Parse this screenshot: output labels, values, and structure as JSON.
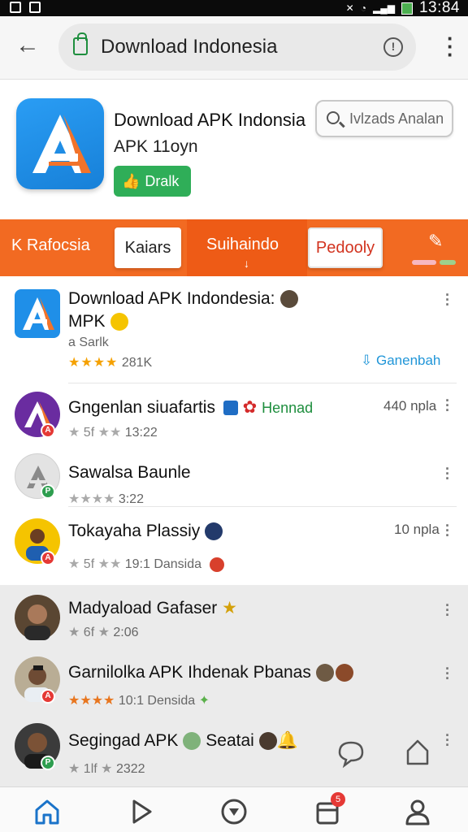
{
  "status_bar": {
    "time": "13:84"
  },
  "url_bar": {
    "title": "Download Indonesia"
  },
  "app_header": {
    "title": "Download APK Indonsia",
    "subtitle": "APK 11oyn",
    "download_label": "Dralk",
    "search_placeholder": "Ivlzads Analan"
  },
  "tabs": [
    {
      "label": "K Rafocsia"
    },
    {
      "label": "Kaiars"
    },
    {
      "label": "Suihaindo"
    },
    {
      "label": "Pedooly"
    }
  ],
  "list": [
    {
      "name": "Download APK Indondesia:",
      "name2": "MPK",
      "sub": "a Sarlk",
      "stars": "★★★★",
      "meta": "281K",
      "right": "Ganenbah",
      "badge_color": "",
      "avatar_color": "#1f8fe8"
    },
    {
      "name": "Gngenlan siuafartis",
      "extra": "Hennad",
      "stars": "★",
      "meta_prefix": "5f",
      "meta": "13:22",
      "right": "440 npla",
      "badge_color": "#e53935",
      "avatar_color": "#6a2ca0"
    },
    {
      "name": "Sawalsa Baunle",
      "stars": "★★★★",
      "meta": "3:22",
      "badge_color": "#2e9e4f",
      "avatar_color": "#e3e3e3"
    },
    {
      "name": "Tokayaha Plassiy",
      "stars": "★",
      "meta_prefix": "5f",
      "meta": "19:1 Dansida",
      "right": "10 npla",
      "badge_color": "#e53935",
      "avatar_color": "#f5c400"
    },
    {
      "name": "Madyaload Gafaser",
      "stars": "★",
      "meta_prefix": "6f",
      "meta": "2:06",
      "badge_color": "",
      "avatar_color": "#5a4632"
    },
    {
      "name": "Garnilolka APK Ihdenak Pbanas",
      "stars": "★★★★",
      "meta": "10:1 Densida",
      "badge_color": "#e53935",
      "avatar_color": "#8a7a62"
    },
    {
      "name": "Segingad APK",
      "extra": "Seatai",
      "stars": "★",
      "meta_prefix": "1lf",
      "meta": "2322",
      "badge_color": "#2e9e4f",
      "avatar_color": "#3b3b3b"
    }
  ],
  "colors": {
    "accent": "#f26a22",
    "green": "#2fae58",
    "blue": "#1f8fe8"
  },
  "bottom_nav": {
    "items": [
      "home-icon",
      "play-icon",
      "explore-icon",
      "inbox-icon",
      "profile-icon"
    ],
    "badge": "5"
  }
}
